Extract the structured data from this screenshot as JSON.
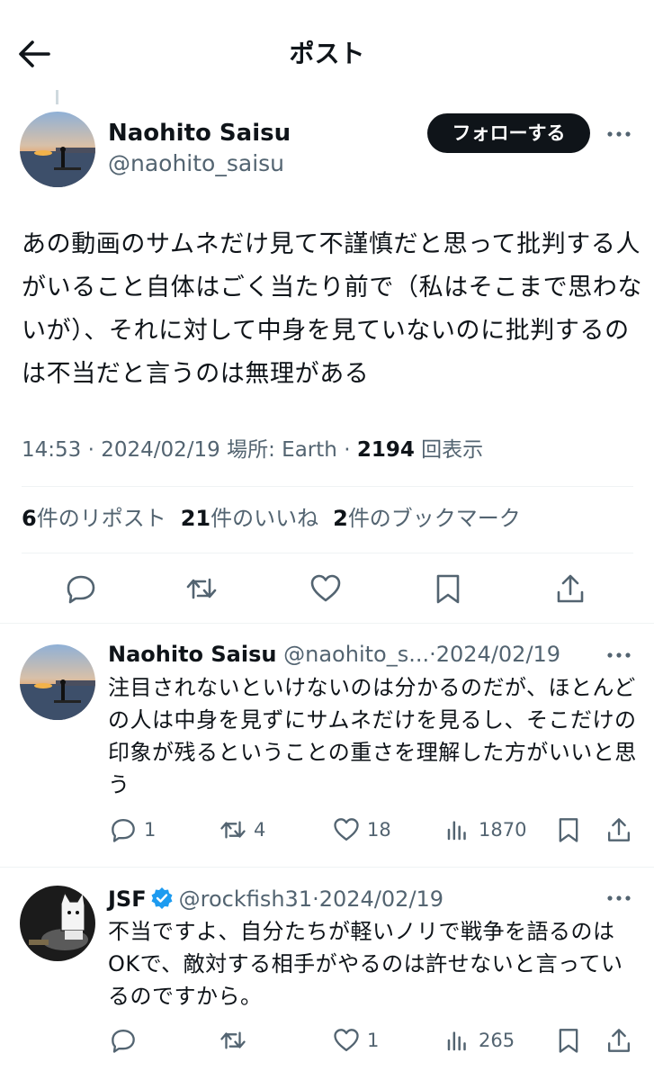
{
  "header": {
    "title": "ポスト"
  },
  "main_post": {
    "author_name": "Naohito Saisu",
    "author_handle": "@naohito_saisu",
    "follow_label": "フォローする",
    "text": "あの動画のサムネだけ見て不謹慎だと思って批判する人がいること自体はごく当たり前で（私はそこまで思わないが）、それに対して中身を見ていないのに批判するのは不当だと言うのは無理がある",
    "time": "14:53",
    "date": "2024/02/19",
    "location_label": "場所: Earth",
    "views_count": "2194",
    "views_label": "回表示",
    "reposts_count": "6",
    "reposts_label": "件のリポスト",
    "likes_count": "21",
    "likes_label": "件のいいね",
    "bookmarks_count": "2",
    "bookmarks_label": "件のブックマーク"
  },
  "replies": [
    {
      "name": "Naohito Saisu",
      "handle": "@naohito_s...",
      "date": "2024/02/19",
      "text": "注目されないといけないのは分かるのだが、ほとんどの人は中身を見ずにサムネだけを見るし、そこだけの印象が残るということの重さを理解した方がいいと思う",
      "replies": "1",
      "reposts": "4",
      "likes": "18",
      "views": "1870"
    },
    {
      "name": "JSF",
      "handle": "@rockfish31",
      "date": "2024/02/19",
      "verified": true,
      "text": "不当ですよ、自分たちが軽いノリで戦争を語るのはOKで、敵対する相手がやるのは許せないと言っているのですから。",
      "replies": "",
      "reposts": "",
      "likes": "1",
      "views": "265"
    }
  ],
  "colors": {
    "text": "#0f1419",
    "secondary": "#536471",
    "verified": "#1d9bf0",
    "divider": "#eff3f4"
  },
  "icons": [
    "back-arrow-icon",
    "more-icon",
    "reply-icon",
    "repost-icon",
    "like-icon",
    "bookmark-icon",
    "share-icon",
    "views-icon",
    "verified-badge-icon"
  ]
}
